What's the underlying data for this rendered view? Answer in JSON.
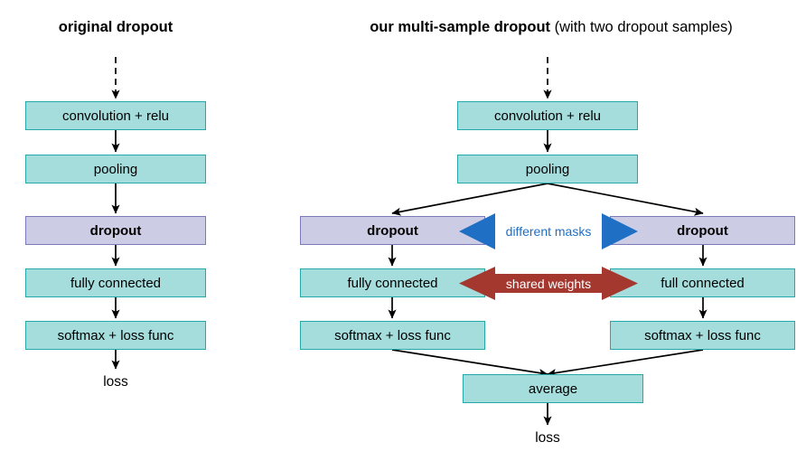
{
  "diagram": {
    "left_panel": {
      "title_bold": "original dropout",
      "title_rest": "",
      "nodes": [
        {
          "id": "conv",
          "label": "convolution + relu",
          "style": "teal"
        },
        {
          "id": "pool",
          "label": "pooling",
          "style": "teal"
        },
        {
          "id": "dropout",
          "label": "dropout",
          "style": "purple"
        },
        {
          "id": "fc",
          "label": "fully connected",
          "style": "teal"
        },
        {
          "id": "softmax",
          "label": "softmax + loss func",
          "style": "teal"
        }
      ],
      "output_label": "loss"
    },
    "right_panel": {
      "title_bold": "our multi-sample dropout",
      "title_rest": " (with two dropout samples)",
      "nodes": [
        {
          "id": "conv",
          "label": "convolution + relu",
          "style": "teal"
        },
        {
          "id": "pool",
          "label": "pooling",
          "style": "teal"
        },
        {
          "id": "dropout-l",
          "label": "dropout",
          "style": "purple"
        },
        {
          "id": "dropout-r",
          "label": "dropout",
          "style": "purple"
        },
        {
          "id": "fc-l",
          "label": "fully connected",
          "style": "teal"
        },
        {
          "id": "fc-r",
          "label": "full connected",
          "style": "teal"
        },
        {
          "id": "softmax-l",
          "label": "softmax + loss func",
          "style": "teal"
        },
        {
          "id": "softmax-r",
          "label": "softmax + loss func",
          "style": "teal"
        },
        {
          "id": "average",
          "label": "average",
          "style": "teal"
        }
      ],
      "relations": [
        {
          "id": "different-masks",
          "label": "different masks",
          "color": "#1f6fc4"
        },
        {
          "id": "shared-weights",
          "label": "shared weights",
          "color": "#a4382f"
        }
      ],
      "output_label": "loss"
    },
    "colors": {
      "teal_fill": "#a5dcdc",
      "teal_border": "#25a8a8",
      "purple_fill": "#ccccE4",
      "purple_border": "#7b7bb9",
      "arrow_blue": "#1f6fc4",
      "arrow_red": "#a4382f",
      "line": "#000000",
      "background": "#ffffff"
    }
  }
}
